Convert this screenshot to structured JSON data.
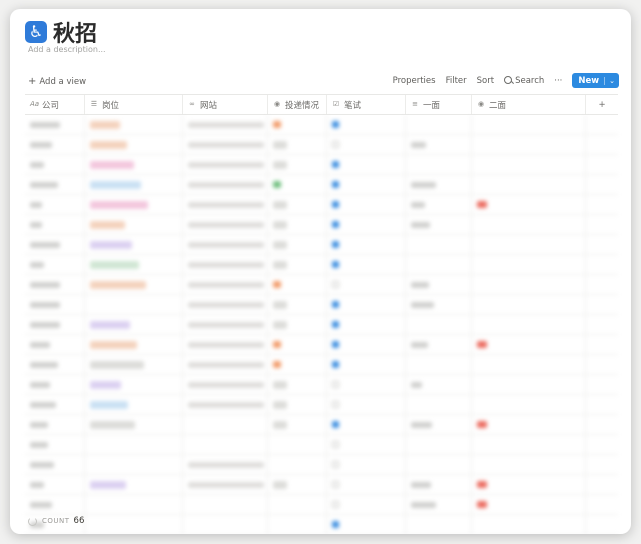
{
  "page": {
    "icon": "wheelchair-icon",
    "title": "秋招",
    "description_placeholder": "Add a description..."
  },
  "toolbar": {
    "add_view": "Add a view",
    "properties": "Properties",
    "filter": "Filter",
    "sort": "Sort",
    "search": "Search",
    "more": "···",
    "new": "New",
    "new_caret": "⌄"
  },
  "columns": [
    {
      "label": "公司",
      "icon": "text-icon"
    },
    {
      "label": "岗位",
      "icon": "list-icon"
    },
    {
      "label": "网站",
      "icon": "link-icon"
    },
    {
      "label": "投递情况",
      "icon": "status-icon"
    },
    {
      "label": "笔试",
      "icon": "checkbox-icon"
    },
    {
      "label": "一面",
      "icon": "text-lines-icon"
    },
    {
      "label": "二面",
      "icon": "status-icon"
    }
  ],
  "add_column": "+",
  "footer": {
    "count_label": "COUNT",
    "count_value": "66"
  },
  "colors": {
    "accent": "#2c8ae0",
    "tag_orange": "#f4d2bd",
    "tag_pink": "#f3c6dd",
    "tag_blue": "#c9e0f3",
    "tag_green": "#cfe6d3",
    "tag_purple": "#dbd0f1",
    "tag_red": "#f6c8c4",
    "tag_gray": "#dcdcd9",
    "status_orange": "#f29c6b",
    "status_green": "#6fbf7e",
    "status_red": "#eb6b5f"
  }
}
